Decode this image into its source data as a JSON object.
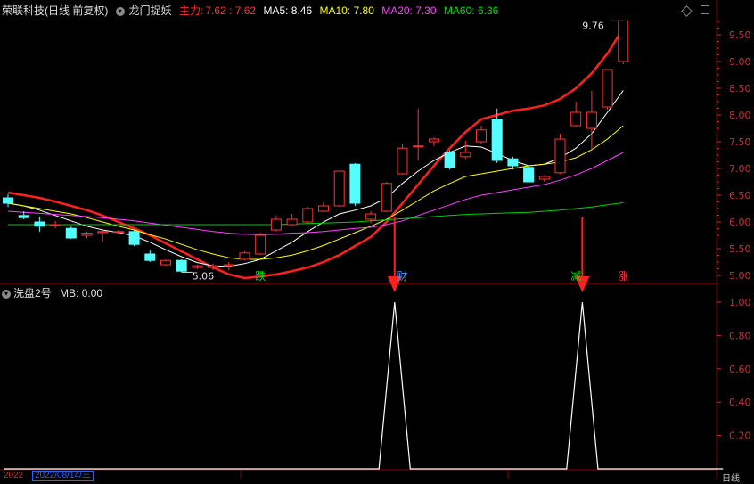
{
  "header": {
    "stock_title": "荣联科技(日线 前复权)",
    "indicator_name": "龙门捉妖",
    "main_label": "主力:",
    "main_value": "7.62 : 7.62",
    "ma5_label": "MA5: 8.46",
    "ma10_label": "MA10: 7.80",
    "ma20_label": "MA20: 7.30",
    "ma60_label": "MA60: 6.36"
  },
  "sub_header": {
    "indicator_name": "洗盘2号",
    "mb_label": "MB: 0.00"
  },
  "bottom": {
    "date_stub": "2022",
    "date_selected": "2022/08/14/三",
    "period": "日线"
  },
  "colors": {
    "background": "#000000",
    "up_candle": "#ff3232",
    "down_candle": "#54ffff",
    "main_line": "#ff2020",
    "ma5": "#ffffff",
    "ma10": "#ffff00",
    "ma20": "#ff40ff",
    "ma60": "#00d000",
    "grid": "#8b0000",
    "axis_text": "#c83232",
    "arrow": "#ff2020",
    "mb_line": "#ffffff"
  },
  "chart_data": [
    {
      "type": "candlestick",
      "title": "荣联科技(日线 前复权)",
      "ylim": [
        4.9,
        9.8
      ],
      "y_ticks": [
        5.0,
        5.5,
        6.0,
        6.5,
        7.0,
        7.5,
        8.0,
        8.5,
        9.0,
        9.5
      ],
      "grid": false,
      "candles": [
        {
          "o": 6.45,
          "h": 6.52,
          "l": 6.28,
          "c": 6.35
        },
        {
          "o": 6.12,
          "h": 6.2,
          "l": 6.05,
          "c": 6.08
        },
        {
          "o": 6.0,
          "h": 6.1,
          "l": 5.82,
          "c": 5.92
        },
        {
          "o": 5.95,
          "h": 6.02,
          "l": 5.88,
          "c": 5.95
        },
        {
          "o": 5.88,
          "h": 5.92,
          "l": 5.68,
          "c": 5.7
        },
        {
          "o": 5.75,
          "h": 5.82,
          "l": 5.7,
          "c": 5.79
        },
        {
          "o": 5.8,
          "h": 5.85,
          "l": 5.62,
          "c": 5.82
        },
        {
          "o": 5.82,
          "h": 5.85,
          "l": 5.8,
          "c": 5.82
        },
        {
          "o": 5.82,
          "h": 5.86,
          "l": 5.55,
          "c": 5.58
        },
        {
          "o": 5.4,
          "h": 5.48,
          "l": 5.25,
          "c": 5.28
        },
        {
          "o": 5.2,
          "h": 5.3,
          "l": 5.18,
          "c": 5.28
        },
        {
          "o": 5.28,
          "h": 5.3,
          "l": 5.06,
          "c": 5.08
        },
        {
          "o": 5.15,
          "h": 5.2,
          "l": 5.12,
          "c": 5.18
        },
        {
          "o": 5.15,
          "h": 5.22,
          "l": 5.1,
          "c": 5.18
        },
        {
          "o": 5.18,
          "h": 5.25,
          "l": 5.1,
          "c": 5.2
        },
        {
          "o": 5.3,
          "h": 5.45,
          "l": 5.28,
          "c": 5.42
        },
        {
          "o": 5.4,
          "h": 5.8,
          "l": 5.38,
          "c": 5.75
        },
        {
          "o": 5.85,
          "h": 6.12,
          "l": 5.82,
          "c": 6.05
        },
        {
          "o": 5.95,
          "h": 6.15,
          "l": 5.92,
          "c": 6.05
        },
        {
          "o": 6.0,
          "h": 6.28,
          "l": 5.98,
          "c": 6.25
        },
        {
          "o": 6.2,
          "h": 6.38,
          "l": 6.18,
          "c": 6.3
        },
        {
          "o": 6.3,
          "h": 6.95,
          "l": 6.28,
          "c": 6.95
        },
        {
          "o": 7.08,
          "h": 7.1,
          "l": 6.3,
          "c": 6.35
        },
        {
          "o": 6.05,
          "h": 6.2,
          "l": 5.98,
          "c": 6.15
        },
        {
          "o": 6.2,
          "h": 6.75,
          "l": 6.18,
          "c": 6.72
        },
        {
          "o": 6.9,
          "h": 7.45,
          "l": 6.88,
          "c": 7.38
        },
        {
          "o": 7.42,
          "h": 8.12,
          "l": 7.15,
          "c": 7.42
        },
        {
          "o": 7.5,
          "h": 7.58,
          "l": 7.42,
          "c": 7.55
        },
        {
          "o": 7.3,
          "h": 7.34,
          "l": 6.98,
          "c": 7.02
        },
        {
          "o": 7.22,
          "h": 7.52,
          "l": 7.18,
          "c": 7.3
        },
        {
          "o": 7.5,
          "h": 7.8,
          "l": 7.45,
          "c": 7.72
        },
        {
          "o": 7.92,
          "h": 8.12,
          "l": 7.1,
          "c": 7.15
        },
        {
          "o": 7.18,
          "h": 7.22,
          "l": 6.98,
          "c": 7.05
        },
        {
          "o": 7.02,
          "h": 7.06,
          "l": 6.74,
          "c": 6.75
        },
        {
          "o": 6.8,
          "h": 6.88,
          "l": 6.75,
          "c": 6.85
        },
        {
          "o": 6.92,
          "h": 7.65,
          "l": 6.9,
          "c": 7.55
        },
        {
          "o": 7.8,
          "h": 8.25,
          "l": 7.78,
          "c": 8.05
        },
        {
          "o": 7.75,
          "h": 8.45,
          "l": 7.35,
          "c": 8.05
        },
        {
          "o": 8.15,
          "h": 8.85,
          "l": 8.1,
          "c": 8.85
        },
        {
          "o": 9.0,
          "h": 9.76,
          "l": 8.95,
          "c": 9.76
        }
      ],
      "series": [
        {
          "name": "主力",
          "values": [
            6.55,
            6.5,
            6.45,
            6.38,
            6.3,
            6.22,
            6.12,
            6.0,
            5.88,
            5.75,
            5.6,
            5.45,
            5.3,
            5.15,
            5.02,
            4.95,
            4.98,
            5.02,
            5.08,
            5.15,
            5.25,
            5.38,
            5.55,
            5.72,
            6.0,
            6.35,
            6.7,
            7.05,
            7.38,
            7.68,
            7.92,
            8.0,
            8.08,
            8.12,
            8.18,
            8.3,
            8.5,
            8.78,
            9.15,
            9.62
          ]
        },
        {
          "name": "MA5",
          "values": [
            6.35,
            6.3,
            6.22,
            6.12,
            6.02,
            5.92,
            5.85,
            5.8,
            5.74,
            5.62,
            5.48,
            5.35,
            5.24,
            5.18,
            5.17,
            5.22,
            5.3,
            5.46,
            5.62,
            5.82,
            6.0,
            6.15,
            6.22,
            6.3,
            6.45,
            6.72,
            6.95,
            7.15,
            7.3,
            7.42,
            7.4,
            7.28,
            7.15,
            7.05,
            7.08,
            7.2,
            7.38,
            7.65,
            8.05,
            8.46
          ]
        },
        {
          "name": "MA10",
          "values": [
            6.35,
            6.3,
            6.25,
            6.2,
            6.15,
            6.08,
            6.0,
            5.92,
            5.85,
            5.76,
            5.68,
            5.58,
            5.48,
            5.4,
            5.33,
            5.3,
            5.3,
            5.33,
            5.38,
            5.46,
            5.56,
            5.68,
            5.8,
            5.92,
            6.05,
            6.22,
            6.4,
            6.58,
            6.72,
            6.85,
            6.9,
            6.95,
            7.0,
            7.05,
            7.08,
            7.12,
            7.2,
            7.35,
            7.55,
            7.8
          ]
        },
        {
          "name": "MA20",
          "values": [
            6.2,
            6.18,
            6.16,
            6.14,
            6.12,
            6.1,
            6.08,
            6.05,
            6.02,
            5.98,
            5.94,
            5.9,
            5.86,
            5.82,
            5.79,
            5.77,
            5.76,
            5.77,
            5.79,
            5.8,
            5.82,
            5.85,
            5.88,
            5.9,
            5.95,
            6.02,
            6.12,
            6.22,
            6.32,
            6.42,
            6.5,
            6.55,
            6.6,
            6.65,
            6.7,
            6.78,
            6.88,
            7.0,
            7.15,
            7.3
          ]
        },
        {
          "name": "MA60",
          "values": [
            5.95,
            5.95,
            5.95,
            5.95,
            5.95,
            5.95,
            5.95,
            5.95,
            5.95,
            5.95,
            5.95,
            5.95,
            5.95,
            5.95,
            5.95,
            5.95,
            5.95,
            5.95,
            5.96,
            5.97,
            5.98,
            5.99,
            6.0,
            6.02,
            6.04,
            6.06,
            6.08,
            6.1,
            6.12,
            6.14,
            6.15,
            6.16,
            6.17,
            6.18,
            6.2,
            6.22,
            6.25,
            6.28,
            6.32,
            6.36
          ]
        }
      ],
      "annotations": [
        {
          "text": "9.76",
          "candle_index": 39,
          "kind": "high"
        },
        {
          "text": "5.06",
          "candle_index": 11,
          "kind": "low"
        },
        {
          "text": "跌",
          "candle_index": 16
        },
        {
          "text": "财",
          "candle_index": 25
        },
        {
          "text": "减",
          "candle_index": 36
        },
        {
          "text": "涨",
          "candle_index": 39
        }
      ]
    },
    {
      "type": "line",
      "title": "洗盘2号",
      "series": [
        {
          "name": "MB",
          "values": [
            0,
            0,
            0,
            0,
            0,
            0,
            0,
            0,
            0,
            0,
            0,
            0,
            0,
            0,
            0,
            0,
            0,
            0,
            0,
            0,
            0,
            0,
            0,
            0,
            0,
            1,
            0,
            0,
            0,
            0,
            0,
            0,
            0,
            0,
            0,
            0,
            0,
            1,
            0,
            0,
            0,
            0,
            0,
            0,
            0,
            0,
            0
          ]
        }
      ],
      "ylim": [
        0,
        1.05
      ],
      "y_ticks": [
        0.2,
        0.4,
        0.6,
        0.8,
        1.0
      ],
      "arrows_at_peaks": true
    }
  ]
}
